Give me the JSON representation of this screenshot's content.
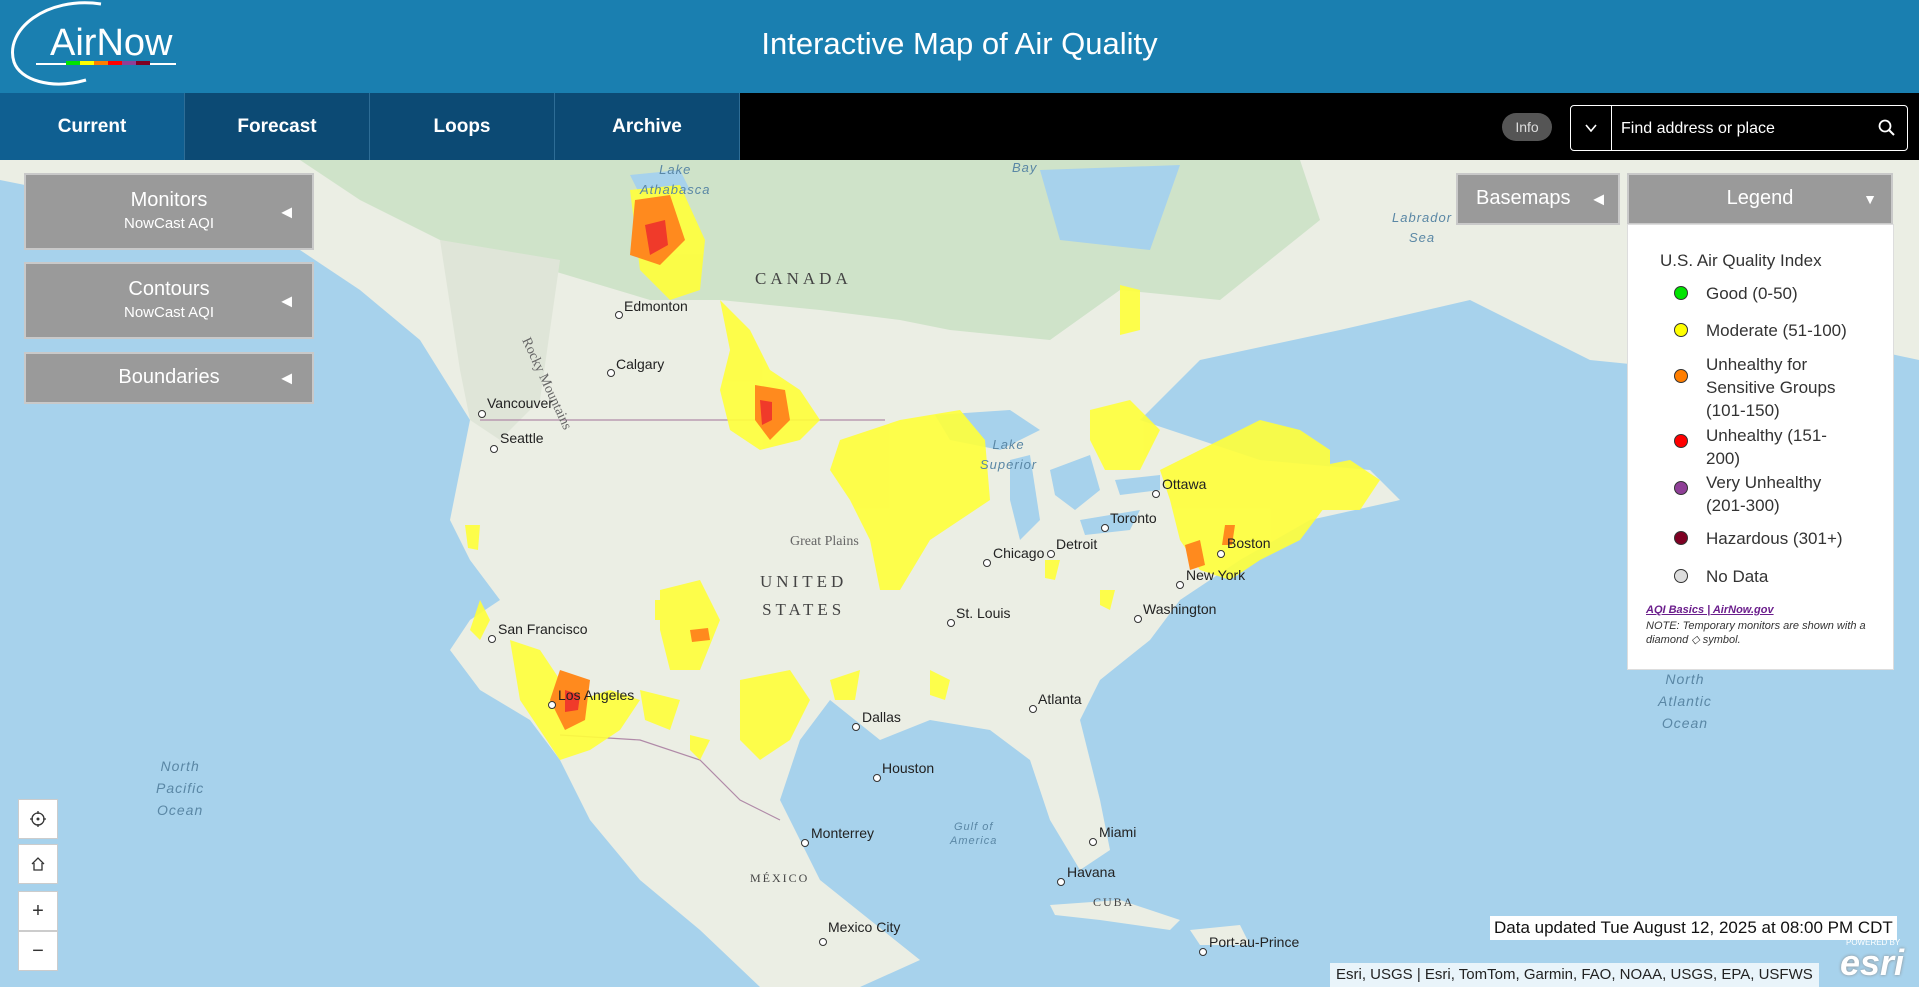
{
  "header": {
    "logo_text": "AirNow",
    "title": "Interactive Map of Air Quality"
  },
  "nav": {
    "tabs": [
      "Current",
      "Forecast",
      "Loops",
      "Archive"
    ],
    "active_tab": "Current",
    "info_label": "Info",
    "search_placeholder": "Find address or place"
  },
  "panels": {
    "monitors": {
      "title": "Monitors",
      "subtitle": "NowCast AQI"
    },
    "contours": {
      "title": "Contours",
      "subtitle": "NowCast AQI"
    },
    "boundaries": {
      "title": "Boundaries"
    },
    "basemaps": {
      "title": "Basemaps"
    },
    "legend": {
      "title": "Legend"
    }
  },
  "legend": {
    "heading": "U.S. Air Quality Index",
    "items": [
      {
        "label": "Good (0-50)",
        "color": "#00e400"
      },
      {
        "label": "Moderate (51-100)",
        "color": "#ffff00"
      },
      {
        "label": "Unhealthy for Sensitive Groups (101-150)",
        "color": "#ff7e00"
      },
      {
        "label": "Unhealthy (151-200)",
        "color": "#ff0000"
      },
      {
        "label": "Very Unhealthy (201-300)",
        "color": "#8f3f97"
      },
      {
        "label": "Hazardous (301+)",
        "color": "#7e0023"
      },
      {
        "label": "No Data",
        "color": "#dddddd"
      }
    ],
    "link_text": "AQI Basics | AirNow.gov",
    "note": "NOTE: Temporary monitors are shown with a diamond ◇ symbol."
  },
  "status": {
    "updated": "Data updated Tue August 12, 2025 at 08:00 PM CDT",
    "attribution": "Esri, USGS | Esri, TomTom, Garmin, FAO, NOAA, USGS, EPA, USFWS",
    "powered_by": "POWERED BY",
    "esri": "esri"
  },
  "map_labels": {
    "countries": {
      "canada": "CANADA",
      "united_states": "UNITED\nSTATES",
      "mexico": "MÉXICO",
      "cuba": "CUBA"
    },
    "regions": {
      "rocky_mountains": "Rocky Mountains",
      "great_plains": "Great Plains"
    },
    "waters": {
      "lake_athabasca": "Lake\nAthabasca",
      "bay": "Bay",
      "labrador_sea": "Labrador\nSea",
      "lake_superior": "Lake\nSuperior",
      "north_pacific": "North\nPacific\nOcean",
      "north_atlantic": "North\nAtlantic\nOcean",
      "gulf_of_america": "Gulf of\nAmerica"
    },
    "cities": [
      {
        "name": "Edmonton"
      },
      {
        "name": "Calgary"
      },
      {
        "name": "Vancouver"
      },
      {
        "name": "Seattle"
      },
      {
        "name": "Ottawa"
      },
      {
        "name": "Toronto"
      },
      {
        "name": "Boston"
      },
      {
        "name": "New York"
      },
      {
        "name": "Washington"
      },
      {
        "name": "Detroit"
      },
      {
        "name": "Chicago"
      },
      {
        "name": "St. Louis"
      },
      {
        "name": "San Francisco"
      },
      {
        "name": "Los Angeles"
      },
      {
        "name": "Dallas"
      },
      {
        "name": "Houston"
      },
      {
        "name": "Atlanta"
      },
      {
        "name": "Monterrey"
      },
      {
        "name": "Miami"
      },
      {
        "name": "Havana"
      },
      {
        "name": "Mexico City"
      },
      {
        "name": "Port-au-Prince"
      }
    ]
  }
}
